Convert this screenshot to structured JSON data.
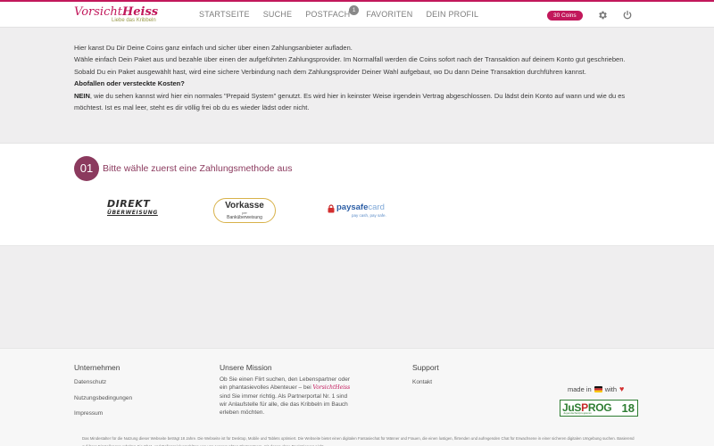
{
  "header": {
    "logo_main_a": "Vorsicht",
    "logo_main_b": "Heiss",
    "logo_tagline": "Liebe das Kribbeln",
    "nav": [
      {
        "label": "STARTSEITE"
      },
      {
        "label": "SUCHE"
      },
      {
        "label": "POSTFACH",
        "badge": "1"
      },
      {
        "label": "FAVORITEN"
      },
      {
        "label": "DEIN PROFIL"
      }
    ],
    "coins": "30 Coins",
    "icons": {
      "settings": "gear-icon",
      "logout": "power-icon"
    },
    "colors": {
      "accent": "#c2185b"
    }
  },
  "info": {
    "p1": "Hier kanst Du Dir Deine Coins ganz einfach und sicher über einen Zahlungsanbieter aufladen.",
    "p2": "Wähle einfach Dein Paket aus und bezahle über einen der aufgeführten Zahlungsprovider. Im Normalfall werden die Coins sofort nach der Transaktion auf deinem Konto gut geschrieben. Sobald Du ein Paket ausgewählt hast, wird eine sichere Verbindung nach dem Zahlungsprovider Deiner Wahl aufgebaut, wo Du dann Deine Transaktion durchführen kannst.",
    "heading": "Abofallen oder versteckte Kosten?",
    "answer_strong": "NEIN",
    "answer_rest": ", wie du sehen kannst wird hier ein normales \"Prepaid System\" genutzt. Es wird hier in keinster Weise irgendein Vertrag abgeschlossen. Du lädst dein Konto auf wann und wie du es möchtest. Ist es mal leer, steht es dir völlig frei ob du es wieder lädst oder nicht."
  },
  "payment": {
    "step_number": "01",
    "step_title": "Bitte wähle zuerst eine Zahlungsmethode aus",
    "methods": {
      "direkt": {
        "line1": "DIREKT",
        "line2": "ÜBERWEISUNG"
      },
      "vorkasse": {
        "line1": "Vorkasse",
        "line2": "per",
        "line3": "Banküberweisung"
      },
      "paysafe": {
        "name_a": "paysafe",
        "name_b": "card",
        "tagline": "pay cash, pay safe."
      }
    }
  },
  "footer": {
    "company": {
      "heading": "Unternehmen",
      "links": [
        "Datenschutz",
        "Nutzungsbedingungen",
        "Impressum"
      ]
    },
    "mission": {
      "heading": "Unsere Mission",
      "text_before": "Ob Sie einen Flirt suchen, den Lebenspartner oder ein phantasievolles Abenteuer – bei ",
      "logo": "VorsichtHeiss",
      "text_after": " sind Sie immer richtig. Als Partnerportal Nr. 1 sind wir Anlaufstelle für alle, die das Kribbeln im Bauch erleben möchten."
    },
    "support": {
      "heading": "Support",
      "links": [
        "Kontakt"
      ]
    },
    "made_in": {
      "prefix": "made in",
      "middle": "with"
    },
    "jusprog": {
      "name_a": "JuS",
      "name_b": "P",
      "name_c": "ROG",
      "number": "18",
      "sub": "Jugendschutzprogramm"
    },
    "legal": "Das Mindestalter für die Nutzung dieser Webseite beträgt 18 Jahre. Die Webseite ist für Desktop, Mobile und Tablets optimiert. Die Webseite bietet einen digitalen Fantasiechat für Männer und Frauen, die einen lustigen, flirtenden und aufregenden Chat für Erwachsene in einer sicheren digitalen Umgebung suchen. Basierend auf ihren Einstellungen erhalten Sie Chat- und Rollenspielvorschläge von uns ausgesuchten Chatpartnern, mit denen ohne Registrierung nicht"
  }
}
